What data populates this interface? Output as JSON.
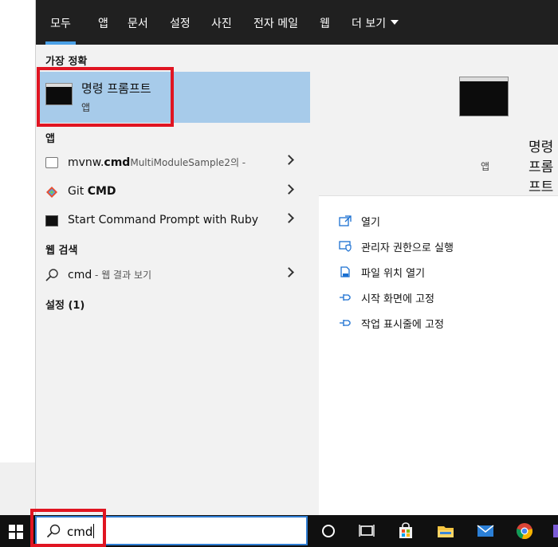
{
  "filter_tabs": [
    "모두",
    "앱",
    "문서",
    "설정",
    "사진",
    "전자 메일",
    "웹",
    "더 보기"
  ],
  "best_match": {
    "header": "가장 정확",
    "title": "명령 프롬프트",
    "subtitle": "앱"
  },
  "apps": {
    "header": "앱",
    "items": [
      {
        "prefix": "mvnw.",
        "bold": "cmd",
        "suffix": "MultiModuleSample2의 -",
        "icon": "file-icon"
      },
      {
        "prefix": "Git ",
        "bold": "CMD",
        "suffix": "",
        "icon": "git-icon"
      },
      {
        "prefix": "Start Command Prompt with Ruby",
        "bold": "",
        "suffix": "",
        "icon": "console-icon"
      }
    ]
  },
  "web": {
    "header": "웹 검색",
    "query": "cmd",
    "suffix": " - 웹 결과 보기"
  },
  "settings": {
    "header": "설정 (1)"
  },
  "detail": {
    "title": "명령 프롬프트",
    "subtitle": "앱",
    "actions": [
      "열기",
      "관리자 권한으로 실행",
      "파일 위치 열기",
      "시작 화면에 고정",
      "작업 표시줄에 고정"
    ]
  },
  "search": {
    "value": "cmd"
  },
  "colors": {
    "accent": "#4aa0e6",
    "highlight": "#a7cbea",
    "annotation": "#e01522"
  }
}
